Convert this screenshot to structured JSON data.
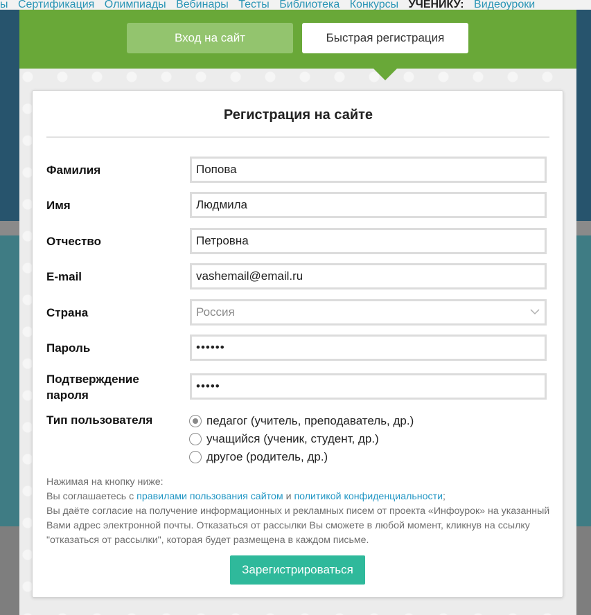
{
  "background": {
    "nav": [
      "ы",
      "Сертификация",
      "Олимпиады",
      "Вебинары",
      "Тесты",
      "Библиотека",
      "Конкурсы"
    ],
    "nav_student_label": "УЧЕНИКУ:",
    "nav_student_link": "Видеоуроки"
  },
  "tabs": {
    "login": "Вход на сайт",
    "register": "Быстрая регистрация"
  },
  "form": {
    "title": "Регистрация на сайте",
    "surname_label": "Фамилия",
    "surname_value": "Попова",
    "name_label": "Имя",
    "name_value": "Людмила",
    "patronymic_label": "Отчество",
    "patronymic_value": "Петровна",
    "email_label": "E-mail",
    "email_value": "vashemail@email.ru",
    "country_label": "Страна",
    "country_value": "Россия",
    "password_label": "Пароль",
    "password_value": "••••••",
    "confirm_label_line1": "Подтверждение",
    "confirm_label_line2": "пароля",
    "confirm_value": "•••••",
    "user_type_label": "Тип пользователя",
    "user_types": [
      {
        "label": "педагог (учитель, преподаватель, др.)",
        "checked": true
      },
      {
        "label": "учащийся (ученик, студент, др.)",
        "checked": false
      },
      {
        "label": "другое (родитель, др.)",
        "checked": false
      }
    ]
  },
  "notice": {
    "line1": "Нажимая на кнопку ниже:",
    "line2_prefix": "Вы соглашаетесь с",
    "rules_link": "правилами пользования сайтом",
    "and": "и",
    "privacy_link": "политикой конфиденциальности",
    "line2_suffix": ";",
    "consent": "Вы даёте согласие на получение информационных и рекламных писем от проекта «Инфоурок» на указанный Вами адрес электронной почты. Отказаться от рассылки Вы сможете в любой момент, кликнув на ссылку \"отказаться от рассылки\", которая будет размещена в каждом письме."
  },
  "submit_label": "Зарегистрироваться",
  "colors": {
    "header_green": "#69a838",
    "login_tab": "#93c46e",
    "submit": "#2fb99b",
    "link": "#2196c4"
  }
}
